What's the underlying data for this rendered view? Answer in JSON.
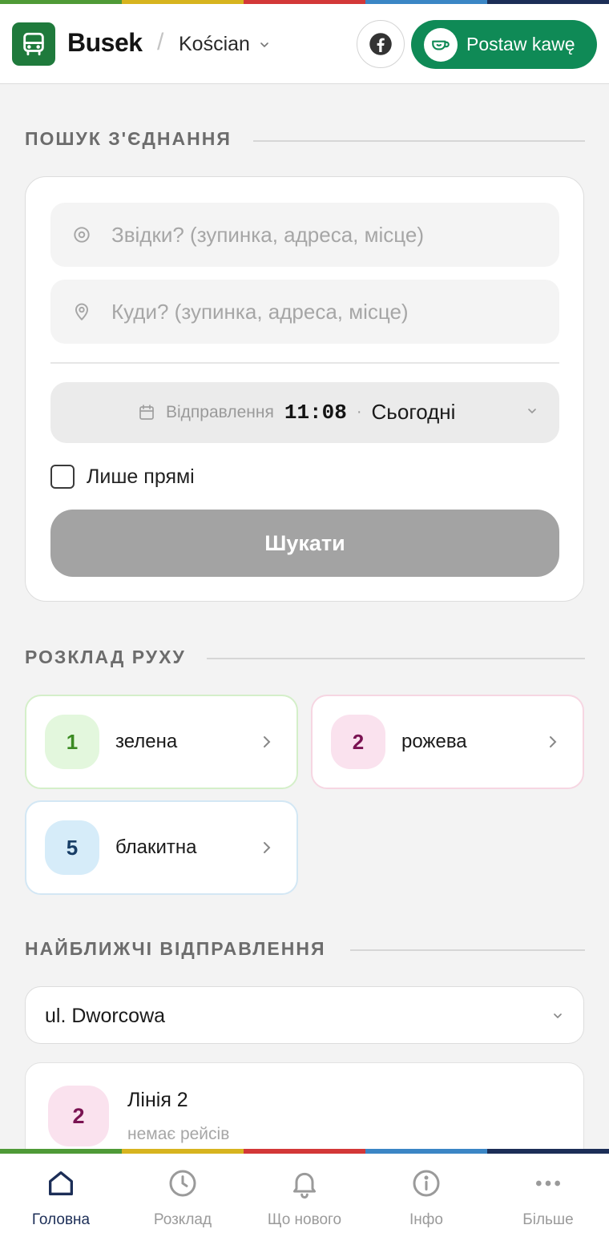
{
  "header": {
    "brand": "Busek",
    "separator": "/",
    "city": "Kościan",
    "coffee_label": "Postaw kawę"
  },
  "accent_colors": [
    "#4f9a37",
    "#d7b41f",
    "#d33838",
    "#3b86c5",
    "#1c2e57"
  ],
  "search": {
    "section_title": "ПОШУК З'ЄДНАННЯ",
    "from_placeholder": "Звідки? (зупинка, адреса, місце)",
    "to_placeholder": "Куди? (зупинка, адреса, місце)",
    "departure_label": "Відправлення",
    "departure_time": "11:08",
    "departure_separator": "·",
    "departure_day": "Сьогодні",
    "direct_only_label": "Лише прямі",
    "search_button": "Шукати"
  },
  "schedule": {
    "section_title": "РОЗКЛАД РУХУ",
    "lines": [
      {
        "number": "1",
        "name": "зелена",
        "badge_bg": "#e3f7dd",
        "badge_fg": "#3b8b22",
        "border": "#d4efc9"
      },
      {
        "number": "2",
        "name": "рожева",
        "badge_bg": "#fae2ee",
        "badge_fg": "#7a1352",
        "border": "#f6d6e2"
      },
      {
        "number": "5",
        "name": "блакитна",
        "badge_bg": "#d6ecf9",
        "badge_fg": "#173d66",
        "border": "#d3e7f4"
      }
    ]
  },
  "departures": {
    "section_title": "НАЙБЛИЖЧІ ВІДПРАВЛЕННЯ",
    "selected_stop": "ul. Dworcowa",
    "items": [
      {
        "badge": "2",
        "line": "Лінія 2",
        "status": "немає рейсів"
      }
    ]
  },
  "bottom_nav": {
    "items": [
      {
        "label": "Головна",
        "icon": "home-icon",
        "active": true
      },
      {
        "label": "Розклад",
        "icon": "clock-icon",
        "active": false
      },
      {
        "label": "Що нового",
        "icon": "bell-icon",
        "active": false
      },
      {
        "label": "Інфо",
        "icon": "info-icon",
        "active": false
      },
      {
        "label": "Більше",
        "icon": "more-icon",
        "active": false
      }
    ]
  }
}
